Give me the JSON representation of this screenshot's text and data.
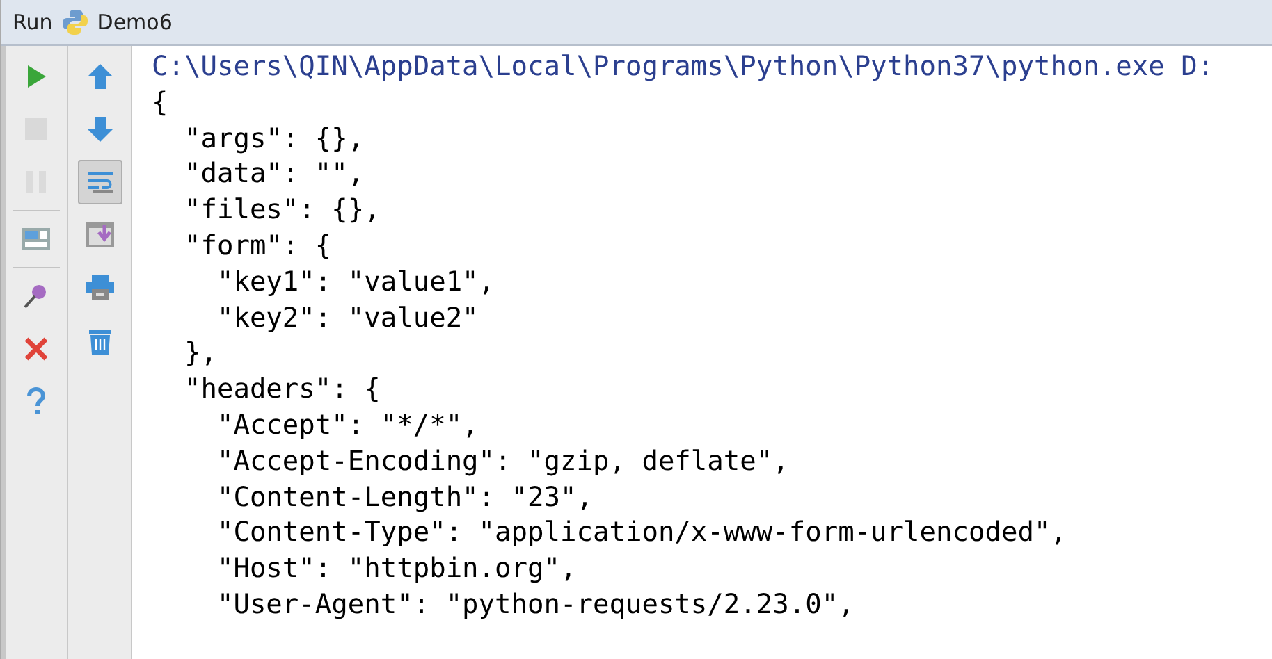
{
  "tool_window": {
    "label": "Run",
    "tab": "Demo6"
  },
  "left_toolbar": [
    {
      "kind": "run",
      "disabled": false
    },
    {
      "kind": "stop",
      "disabled": true
    },
    {
      "kind": "pause",
      "disabled": true
    },
    {
      "kind": "layout",
      "disabled": false
    },
    {
      "kind": "pin",
      "disabled": false
    },
    {
      "kind": "close",
      "disabled": false
    },
    {
      "kind": "help",
      "disabled": false
    }
  ],
  "right_toolbar": [
    {
      "kind": "up",
      "selected": false
    },
    {
      "kind": "down",
      "selected": false
    },
    {
      "kind": "wrap",
      "selected": true
    },
    {
      "kind": "scroll",
      "selected": false
    },
    {
      "kind": "print",
      "selected": false
    },
    {
      "kind": "trash",
      "selected": false
    }
  ],
  "console_lines": [
    {
      "kind": "command",
      "text": "C:\\Users\\QIN\\AppData\\Local\\Programs\\Python\\Python37\\python.exe D:"
    },
    {
      "kind": "output",
      "text": "{"
    },
    {
      "kind": "output",
      "text": "  \"args\": {},"
    },
    {
      "kind": "output",
      "text": "  \"data\": \"\","
    },
    {
      "kind": "output",
      "text": "  \"files\": {},"
    },
    {
      "kind": "output",
      "text": "  \"form\": {"
    },
    {
      "kind": "output",
      "text": "    \"key1\": \"value1\","
    },
    {
      "kind": "output",
      "text": "    \"key2\": \"value2\""
    },
    {
      "kind": "output",
      "text": "  },"
    },
    {
      "kind": "output",
      "text": "  \"headers\": {"
    },
    {
      "kind": "output",
      "text": "    \"Accept\": \"*/*\","
    },
    {
      "kind": "output",
      "text": "    \"Accept-Encoding\": \"gzip, deflate\","
    },
    {
      "kind": "output",
      "text": "    \"Content-Length\": \"23\","
    },
    {
      "kind": "output",
      "text": "    \"Content-Type\": \"application/x-www-form-urlencoded\","
    },
    {
      "kind": "output",
      "text": "    \"Host\": \"httpbin.org\","
    },
    {
      "kind": "output",
      "text": "    \"User-Agent\": \"python-requests/2.23.0\","
    }
  ]
}
